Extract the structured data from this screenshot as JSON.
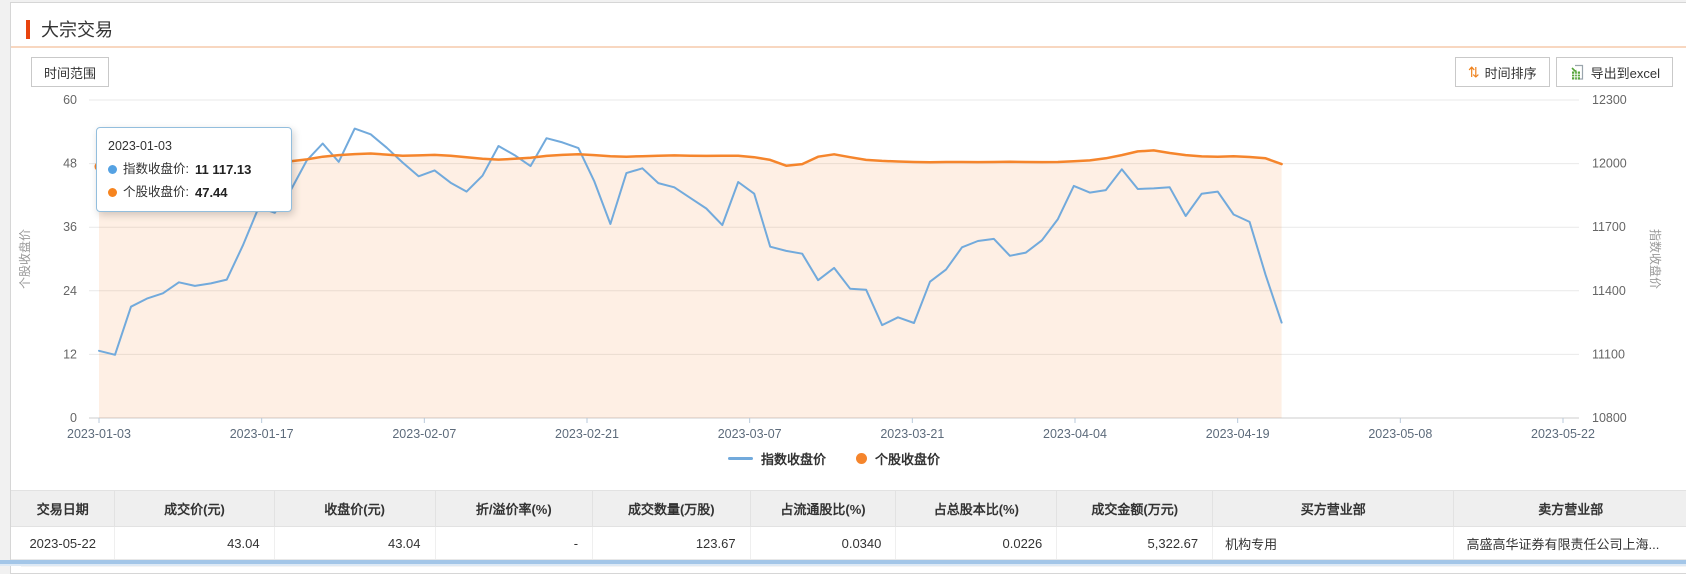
{
  "page": {
    "title": "大宗交易"
  },
  "toolbar": {
    "time_range_label": "时间范围",
    "sort_label": "时间排序",
    "export_label": "导出到excel"
  },
  "chart_data": {
    "type": "line",
    "title": "",
    "x_labels": [
      "2023-01-03",
      "2023-01-17",
      "2023-02-07",
      "2023-02-21",
      "2023-03-07",
      "2023-03-21",
      "2023-04-04",
      "2023-04-19",
      "2023-05-08",
      "2023-05-22"
    ],
    "left_axis": {
      "title": "个股收盘价",
      "min": 0,
      "max": 60,
      "ticks": [
        0,
        12,
        24,
        36,
        48,
        60
      ]
    },
    "right_axis": {
      "title": "指数收盘价",
      "min": 10800,
      "max": 12300,
      "ticks": [
        10800,
        11100,
        11400,
        11700,
        12000,
        12300
      ]
    },
    "legend": [
      "指数收盘价",
      "个股收盘价"
    ],
    "legend_position": "bottom-center",
    "grid": true,
    "data_end_ticks": 7.27,
    "series": [
      {
        "name": "指数收盘价",
        "axis": "right",
        "values": [
          11117.13,
          11098,
          11325,
          11363,
          11388,
          11440,
          11423,
          11435,
          11453,
          11613,
          11795,
          11768,
          11875,
          12015,
          12095,
          12008,
          12165,
          12138,
          12075,
          12005,
          11940,
          11968,
          11910,
          11868,
          11943,
          12083,
          12040,
          11988,
          12120,
          12100,
          12073,
          11915,
          11715,
          11955,
          11978,
          11908,
          11888,
          11838,
          11788,
          11710,
          11913,
          11858,
          11608,
          11588,
          11575,
          11450,
          11508,
          11410,
          11405,
          11238,
          11275,
          11248,
          11443,
          11500,
          11605,
          11635,
          11645,
          11565,
          11580,
          11638,
          11738,
          11895,
          11863,
          11875,
          11973,
          11880,
          11883,
          11888,
          11753,
          11858,
          11868,
          11760,
          11725,
          11475,
          11250
        ]
      },
      {
        "name": "个股收盘价",
        "axis": "left",
        "values": [
          47.44,
          47.5,
          47.5,
          47.55,
          47.6,
          47.6,
          47.65,
          47.7,
          47.7,
          47.8,
          47.95,
          48.15,
          48.45,
          48.8,
          49.3,
          49.6,
          49.8,
          49.9,
          49.7,
          49.5,
          49.55,
          49.65,
          49.5,
          49.2,
          48.9,
          48.75,
          48.9,
          49.1,
          49.45,
          49.65,
          49.75,
          49.6,
          49.4,
          49.3,
          49.4,
          49.5,
          49.55,
          49.5,
          49.45,
          49.5,
          49.5,
          49.2,
          48.7,
          47.6,
          47.9,
          49.3,
          49.75,
          49.2,
          48.7,
          48.5,
          48.4,
          48.3,
          48.25,
          48.3,
          48.3,
          48.28,
          48.3,
          48.35,
          48.3,
          48.28,
          48.3,
          48.45,
          48.6,
          49.0,
          49.6,
          50.3,
          50.5,
          50.0,
          49.6,
          49.35,
          49.3,
          49.4,
          49.25,
          49.0,
          47.9
        ]
      }
    ],
    "colors": {
      "index": "#72aadc",
      "stock": "#f5852c",
      "area": "rgba(246,133,44,0.13)",
      "grid": "#e9e9e9",
      "axis": "#cccccc",
      "tick": "#b9cadb",
      "label": "#666666",
      "axis_title": "#999999"
    },
    "tooltip": {
      "date": "2023-01-03",
      "rows": [
        {
          "label": "指数收盘价:",
          "value": "11 117.13",
          "color": "#55a2e3"
        },
        {
          "label": "个股收盘价:",
          "value": "47.44",
          "color": "#f6841f"
        }
      ]
    }
  },
  "table": {
    "headers": [
      "交易日期",
      "成交价(元)",
      "收盘价(元)",
      "折/溢价率(%)",
      "成交数量(万股)",
      "占流通股比(%)",
      "占总股本比(%)",
      "成交金额(万元)",
      "买方营业部",
      "卖方营业部"
    ],
    "rows": [
      [
        "2023-05-22",
        "43.04",
        "43.04",
        "-",
        "123.67",
        "0.0340",
        "0.0226",
        "5,322.67",
        "机构专用",
        "高盛高华证券有限责任公司上海..."
      ]
    ]
  }
}
